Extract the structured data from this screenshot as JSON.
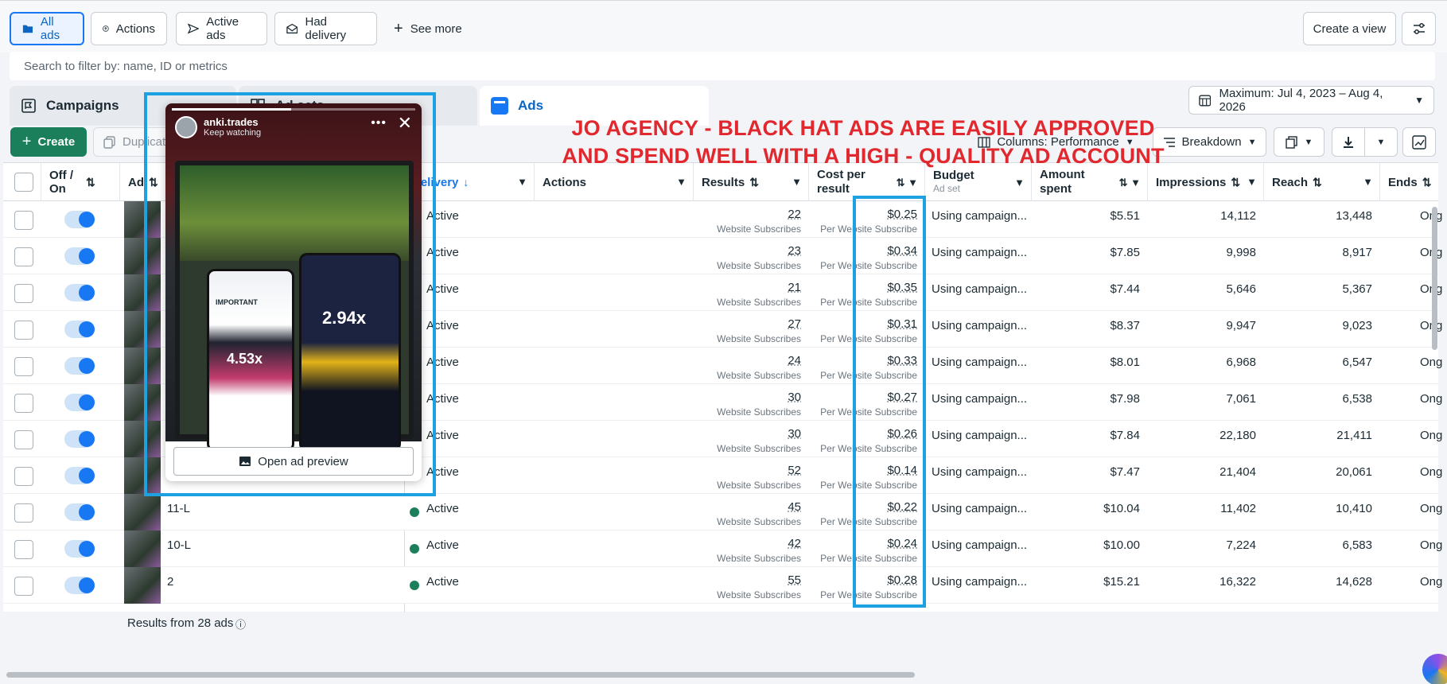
{
  "filters": {
    "all_ads": "All ads",
    "actions": "Actions",
    "active_ads": "Active ads",
    "had_delivery": "Had delivery",
    "see_more": "See more",
    "create_view": "Create a view"
  },
  "search": {
    "placeholder": "Search to filter by: name, ID or metrics"
  },
  "tabs": {
    "campaigns": "Campaigns",
    "adsets": "Ad sets",
    "ads": "Ads"
  },
  "date_range": "Maximum: Jul 4, 2023 – Aug 4, 2026",
  "toolbar": {
    "create": "Create",
    "duplicate": "Duplicate",
    "columns": "Columns: Performance",
    "breakdown": "Breakdown"
  },
  "columns": {
    "off_on": "Off / On",
    "ad": "Ad",
    "delivery": "Delivery",
    "actions": "Actions",
    "results": "Results",
    "cost_per_result": "Cost per result",
    "budget": "Budget",
    "budget_sub": "Ad set",
    "amount_spent": "Amount spent",
    "impressions": "Impressions",
    "reach": "Reach",
    "ends": "Ends"
  },
  "rows": [
    {
      "name": "",
      "delivery": "Active",
      "results": "22",
      "results_label": "Website Subscribes",
      "cost": "$0.25",
      "cost_label": "Per Website Subscribe",
      "budget": "Using campaign...",
      "spent": "$5.51",
      "impressions": "14,112",
      "reach": "13,448",
      "ends": "Ong"
    },
    {
      "name": "",
      "delivery": "Active",
      "results": "23",
      "results_label": "Website Subscribes",
      "cost": "$0.34",
      "cost_label": "Per Website Subscribe",
      "budget": "Using campaign...",
      "spent": "$7.85",
      "impressions": "9,998",
      "reach": "8,917",
      "ends": "Ong"
    },
    {
      "name": "",
      "delivery": "Active",
      "results": "21",
      "results_label": "Website Subscribes",
      "cost": "$0.35",
      "cost_label": "Per Website Subscribe",
      "budget": "Using campaign...",
      "spent": "$7.44",
      "impressions": "5,646",
      "reach": "5,367",
      "ends": "Ong"
    },
    {
      "name": "",
      "delivery": "Active",
      "results": "27",
      "results_label": "Website Subscribes",
      "cost": "$0.31",
      "cost_label": "Per Website Subscribe",
      "budget": "Using campaign...",
      "spent": "$8.37",
      "impressions": "9,947",
      "reach": "9,023",
      "ends": "Ong"
    },
    {
      "name": "",
      "delivery": "Active",
      "results": "24",
      "results_label": "Website Subscribes",
      "cost": "$0.33",
      "cost_label": "Per Website Subscribe",
      "budget": "Using campaign...",
      "spent": "$8.01",
      "impressions": "6,968",
      "reach": "6,547",
      "ends": "Ong"
    },
    {
      "name": "",
      "delivery": "Active",
      "results": "30",
      "results_label": "Website Subscribes",
      "cost": "$0.27",
      "cost_label": "Per Website Subscribe",
      "budget": "Using campaign...",
      "spent": "$7.98",
      "impressions": "7,061",
      "reach": "6,538",
      "ends": "Ong"
    },
    {
      "name": "",
      "delivery": "Active",
      "results": "30",
      "results_label": "Website Subscribes",
      "cost": "$0.26",
      "cost_label": "Per Website Subscribe",
      "budget": "Using campaign...",
      "spent": "$7.84",
      "impressions": "22,180",
      "reach": "21,411",
      "ends": "Ong"
    },
    {
      "name": "",
      "delivery": "Active",
      "results": "52",
      "results_label": "Website Subscribes",
      "cost": "$0.14",
      "cost_label": "Per Website Subscribe",
      "budget": "Using campaign...",
      "spent": "$7.47",
      "impressions": "21,404",
      "reach": "20,061",
      "ends": "Ong"
    },
    {
      "name": "11-L",
      "delivery": "Active",
      "results": "45",
      "results_label": "Website Subscribes",
      "cost": "$0.22",
      "cost_label": "Per Website Subscribe",
      "budget": "Using campaign...",
      "spent": "$10.04",
      "impressions": "11,402",
      "reach": "10,410",
      "ends": "Ong"
    },
    {
      "name": "10-L",
      "delivery": "Active",
      "results": "42",
      "results_label": "Website Subscribes",
      "cost": "$0.24",
      "cost_label": "Per Website Subscribe",
      "budget": "Using campaign...",
      "spent": "$10.00",
      "impressions": "7,224",
      "reach": "6,583",
      "ends": "Ong"
    },
    {
      "name": "2",
      "delivery": "Active",
      "results": "55",
      "results_label": "Website Subscribes",
      "cost": "$0.28",
      "cost_label": "Per Website Subscribe",
      "budget": "Using campaign...",
      "spent": "$15.21",
      "impressions": "16,322",
      "reach": "14,628",
      "ends": "Ong"
    }
  ],
  "footer": "Results from 28 ads",
  "popup": {
    "username": "anki.trades",
    "subtitle": "Keep watching",
    "mult_a": "4.53x",
    "mult_b": "2.94x",
    "important": "IMPORTANT",
    "open_preview": "Open ad preview"
  },
  "banner": {
    "line1": "JO AGENCY - BLACK HAT ADS ARE EASILY APPROVED",
    "line2": "AND SPEND WELL WITH A HIGH - QUALITY AD ACCOUNT"
  },
  "colors": {
    "accent": "#1877f2",
    "create_green": "#1a7f5a",
    "highlight": "#1da1e0",
    "banner_red": "#e0282e"
  },
  "toggles_on": [
    true,
    true,
    true,
    true,
    true,
    true,
    true,
    true,
    true,
    true,
    true
  ]
}
